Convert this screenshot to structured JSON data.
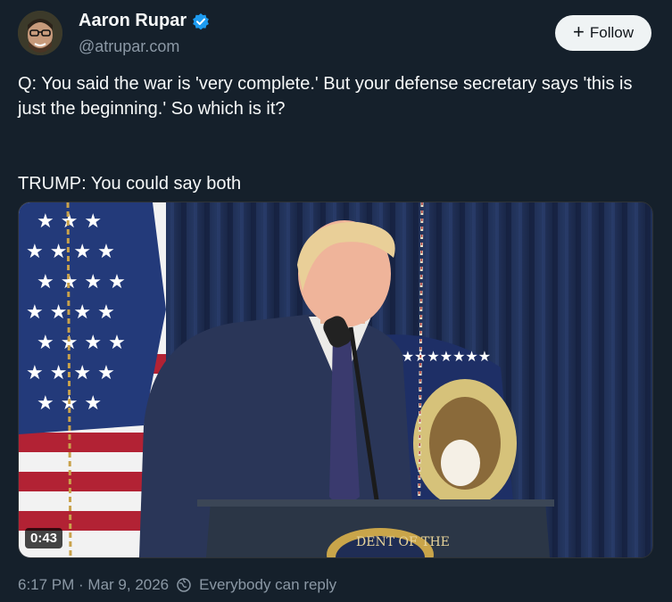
{
  "author": {
    "name": "Aaron Rupar",
    "handle": "@atrupar.com",
    "verified_icon": "verified-badge-icon",
    "accent_color": "#1d9bf0"
  },
  "follow_button": {
    "icon": "plus-icon",
    "label": "Follow"
  },
  "tweet": {
    "paragraphs": [
      "Q: You said the war is 'very complete.' But your defense secretary says 'this is just the beginning.' So which is it?",
      "TRUMP: You could say both"
    ]
  },
  "media": {
    "type": "video",
    "duration": "0:43",
    "seal_text": "DENT OF THE"
  },
  "footer": {
    "timestamp": "6:17 PM · Mar 9, 2026",
    "reply_icon": "globe-reply-icon",
    "reply_setting": "Everybody can reply"
  }
}
